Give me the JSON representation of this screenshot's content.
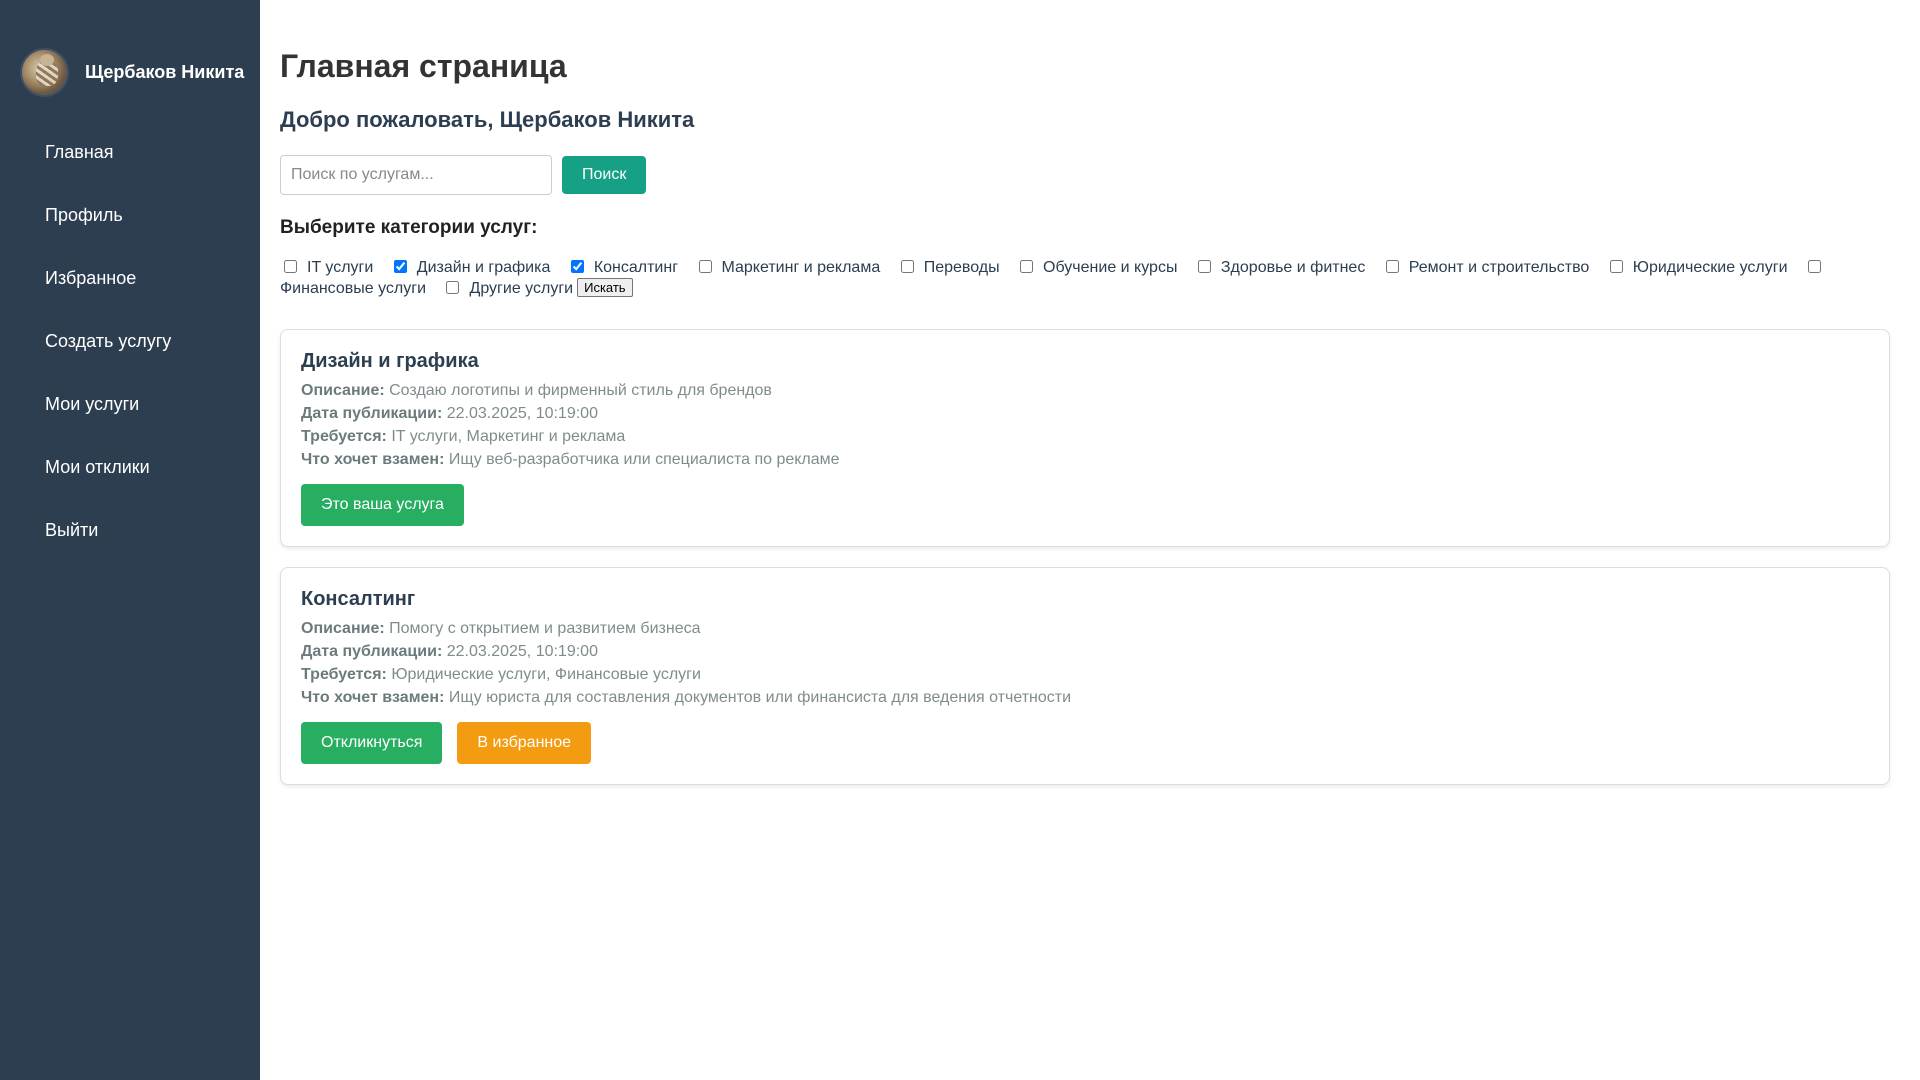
{
  "sidebar": {
    "user_name": "Щербаков Никита",
    "items": [
      {
        "label": "Главная"
      },
      {
        "label": "Профиль"
      },
      {
        "label": "Избранное"
      },
      {
        "label": "Создать услугу"
      },
      {
        "label": "Мои услуги"
      },
      {
        "label": "Мои отклики"
      },
      {
        "label": "Выйти"
      }
    ]
  },
  "main": {
    "title": "Главная страница",
    "welcome": "Добро пожаловать, Щербаков Никита",
    "search": {
      "placeholder": "Поиск по услугам...",
      "value": "",
      "button_label": "Поиск"
    },
    "categories": {
      "title": "Выберите категории услуг:",
      "items": [
        {
          "label": "IT услуги",
          "checked": false
        },
        {
          "label": "Дизайн и графика",
          "checked": true
        },
        {
          "label": "Консалтинг",
          "checked": true
        },
        {
          "label": "Маркетинг и реклама",
          "checked": false
        },
        {
          "label": "Переводы",
          "checked": false
        },
        {
          "label": "Обучение и курсы",
          "checked": false
        },
        {
          "label": "Здоровье и фитнес",
          "checked": false
        },
        {
          "label": "Ремонт и строительство",
          "checked": false
        },
        {
          "label": "Юридические услуги",
          "checked": false
        },
        {
          "label": "Финансовые услуги",
          "checked": false
        },
        {
          "label": "Другие услуги",
          "checked": false
        }
      ],
      "search_button_label": "Искать"
    },
    "field_labels": {
      "description": "Описание:",
      "date": "Дата публикации:",
      "required": "Требуется:",
      "wants": "Что хочет взамен:"
    },
    "cards": [
      {
        "title": "Дизайн и графика",
        "description": "Создаю логотипы и фирменный стиль для брендов",
        "date": "22.03.2025, 10:19:00",
        "required": "IT услуги, Маркетинг и реклама",
        "wants": "Ищу веб-разработчика или специалиста по рекламе",
        "own_label": "Это ваша услуга"
      },
      {
        "title": "Консалтинг",
        "description": "Помогу с открытием и развитием бизнеса",
        "date": "22.03.2025, 10:19:00",
        "required": "Юридические услуги, Финансовые услуги",
        "wants": "Ищу юриста для составления документов или финансиста для ведения отчетности",
        "respond_label": "Откликнуться",
        "favorite_label": "В избранное"
      }
    ]
  },
  "colors": {
    "sidebar_bg": "#2c3e50",
    "search_button": "#16a085",
    "primary_button": "#27ae60",
    "favorite_button": "#f39c12"
  }
}
